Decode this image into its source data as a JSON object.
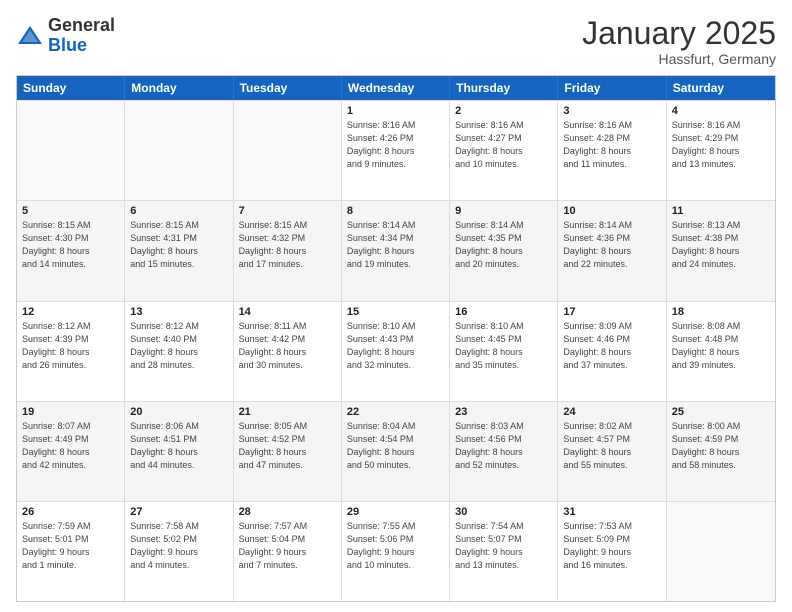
{
  "logo": {
    "general": "General",
    "blue": "Blue"
  },
  "header": {
    "title": "January 2025",
    "location": "Hassfurt, Germany"
  },
  "weekdays": [
    "Sunday",
    "Monday",
    "Tuesday",
    "Wednesday",
    "Thursday",
    "Friday",
    "Saturday"
  ],
  "rows": [
    [
      {
        "day": "",
        "info": "",
        "empty": true
      },
      {
        "day": "",
        "info": "",
        "empty": true
      },
      {
        "day": "",
        "info": "",
        "empty": true
      },
      {
        "day": "1",
        "info": "Sunrise: 8:16 AM\nSunset: 4:26 PM\nDaylight: 8 hours\nand 9 minutes."
      },
      {
        "day": "2",
        "info": "Sunrise: 8:16 AM\nSunset: 4:27 PM\nDaylight: 8 hours\nand 10 minutes."
      },
      {
        "day": "3",
        "info": "Sunrise: 8:16 AM\nSunset: 4:28 PM\nDaylight: 8 hours\nand 11 minutes."
      },
      {
        "day": "4",
        "info": "Sunrise: 8:16 AM\nSunset: 4:29 PM\nDaylight: 8 hours\nand 13 minutes."
      }
    ],
    [
      {
        "day": "5",
        "info": "Sunrise: 8:15 AM\nSunset: 4:30 PM\nDaylight: 8 hours\nand 14 minutes."
      },
      {
        "day": "6",
        "info": "Sunrise: 8:15 AM\nSunset: 4:31 PM\nDaylight: 8 hours\nand 15 minutes."
      },
      {
        "day": "7",
        "info": "Sunrise: 8:15 AM\nSunset: 4:32 PM\nDaylight: 8 hours\nand 17 minutes."
      },
      {
        "day": "8",
        "info": "Sunrise: 8:14 AM\nSunset: 4:34 PM\nDaylight: 8 hours\nand 19 minutes."
      },
      {
        "day": "9",
        "info": "Sunrise: 8:14 AM\nSunset: 4:35 PM\nDaylight: 8 hours\nand 20 minutes."
      },
      {
        "day": "10",
        "info": "Sunrise: 8:14 AM\nSunset: 4:36 PM\nDaylight: 8 hours\nand 22 minutes."
      },
      {
        "day": "11",
        "info": "Sunrise: 8:13 AM\nSunset: 4:38 PM\nDaylight: 8 hours\nand 24 minutes."
      }
    ],
    [
      {
        "day": "12",
        "info": "Sunrise: 8:12 AM\nSunset: 4:39 PM\nDaylight: 8 hours\nand 26 minutes."
      },
      {
        "day": "13",
        "info": "Sunrise: 8:12 AM\nSunset: 4:40 PM\nDaylight: 8 hours\nand 28 minutes."
      },
      {
        "day": "14",
        "info": "Sunrise: 8:11 AM\nSunset: 4:42 PM\nDaylight: 8 hours\nand 30 minutes."
      },
      {
        "day": "15",
        "info": "Sunrise: 8:10 AM\nSunset: 4:43 PM\nDaylight: 8 hours\nand 32 minutes."
      },
      {
        "day": "16",
        "info": "Sunrise: 8:10 AM\nSunset: 4:45 PM\nDaylight: 8 hours\nand 35 minutes."
      },
      {
        "day": "17",
        "info": "Sunrise: 8:09 AM\nSunset: 4:46 PM\nDaylight: 8 hours\nand 37 minutes."
      },
      {
        "day": "18",
        "info": "Sunrise: 8:08 AM\nSunset: 4:48 PM\nDaylight: 8 hours\nand 39 minutes."
      }
    ],
    [
      {
        "day": "19",
        "info": "Sunrise: 8:07 AM\nSunset: 4:49 PM\nDaylight: 8 hours\nand 42 minutes."
      },
      {
        "day": "20",
        "info": "Sunrise: 8:06 AM\nSunset: 4:51 PM\nDaylight: 8 hours\nand 44 minutes."
      },
      {
        "day": "21",
        "info": "Sunrise: 8:05 AM\nSunset: 4:52 PM\nDaylight: 8 hours\nand 47 minutes."
      },
      {
        "day": "22",
        "info": "Sunrise: 8:04 AM\nSunset: 4:54 PM\nDaylight: 8 hours\nand 50 minutes."
      },
      {
        "day": "23",
        "info": "Sunrise: 8:03 AM\nSunset: 4:56 PM\nDaylight: 8 hours\nand 52 minutes."
      },
      {
        "day": "24",
        "info": "Sunrise: 8:02 AM\nSunset: 4:57 PM\nDaylight: 8 hours\nand 55 minutes."
      },
      {
        "day": "25",
        "info": "Sunrise: 8:00 AM\nSunset: 4:59 PM\nDaylight: 8 hours\nand 58 minutes."
      }
    ],
    [
      {
        "day": "26",
        "info": "Sunrise: 7:59 AM\nSunset: 5:01 PM\nDaylight: 9 hours\nand 1 minute."
      },
      {
        "day": "27",
        "info": "Sunrise: 7:58 AM\nSunset: 5:02 PM\nDaylight: 9 hours\nand 4 minutes."
      },
      {
        "day": "28",
        "info": "Sunrise: 7:57 AM\nSunset: 5:04 PM\nDaylight: 9 hours\nand 7 minutes."
      },
      {
        "day": "29",
        "info": "Sunrise: 7:55 AM\nSunset: 5:06 PM\nDaylight: 9 hours\nand 10 minutes."
      },
      {
        "day": "30",
        "info": "Sunrise: 7:54 AM\nSunset: 5:07 PM\nDaylight: 9 hours\nand 13 minutes."
      },
      {
        "day": "31",
        "info": "Sunrise: 7:53 AM\nSunset: 5:09 PM\nDaylight: 9 hours\nand 16 minutes."
      },
      {
        "day": "",
        "info": "",
        "empty": true
      }
    ]
  ]
}
